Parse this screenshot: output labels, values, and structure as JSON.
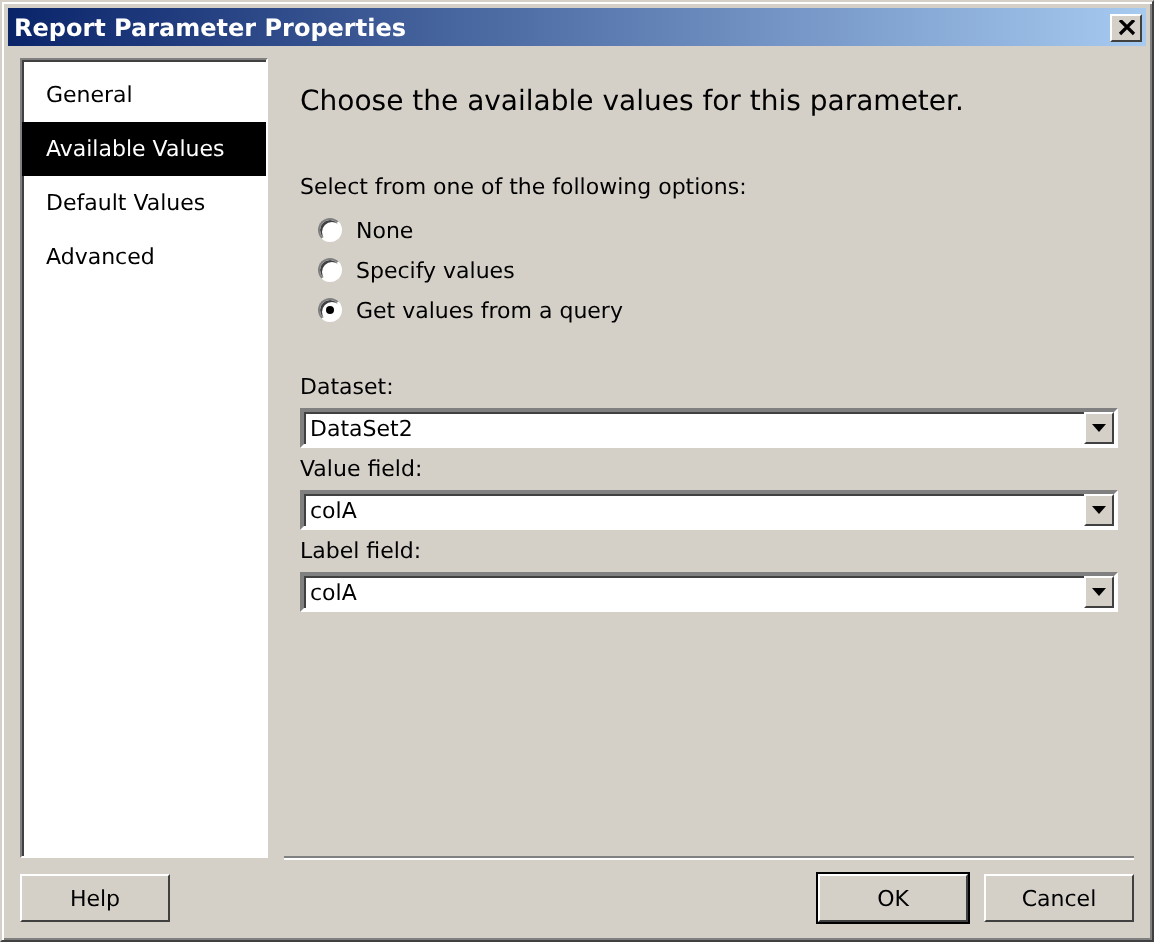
{
  "window": {
    "title": "Report Parameter Properties"
  },
  "sidebar": {
    "items": [
      {
        "label": "General",
        "selected": false
      },
      {
        "label": "Available Values",
        "selected": true
      },
      {
        "label": "Default Values",
        "selected": false
      },
      {
        "label": "Advanced",
        "selected": false
      }
    ]
  },
  "heading": "Choose the available values for this parameter.",
  "options": {
    "label": "Select from one of the following options:",
    "items": [
      {
        "label": "None",
        "selected": false
      },
      {
        "label": "Specify values",
        "selected": false
      },
      {
        "label": "Get values from a query",
        "selected": true
      }
    ]
  },
  "fields": [
    {
      "label": "Dataset:",
      "value": "DataSet2"
    },
    {
      "label": "Value field:",
      "value": "colA"
    },
    {
      "label": "Label field:",
      "value": "colA"
    }
  ],
  "buttons": {
    "help": "Help",
    "ok": "OK",
    "cancel": "Cancel"
  }
}
